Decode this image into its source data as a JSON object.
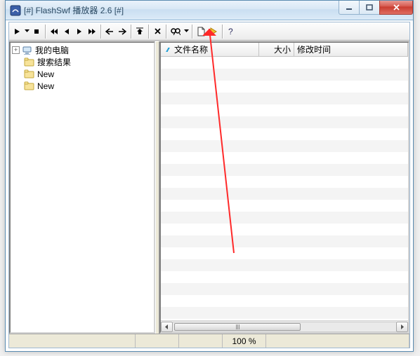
{
  "window": {
    "title": "[#] FlashSwf 播放器 2.6 [#]"
  },
  "tree": {
    "root": {
      "label": "我的电脑",
      "expanded": false
    },
    "items": [
      {
        "label": "搜索结果"
      },
      {
        "label": "New"
      },
      {
        "label": "New"
      }
    ]
  },
  "list": {
    "columns": {
      "name": "文件名称",
      "size": "大小",
      "modified": "修改时间"
    }
  },
  "status": {
    "zoom": "100 %"
  }
}
